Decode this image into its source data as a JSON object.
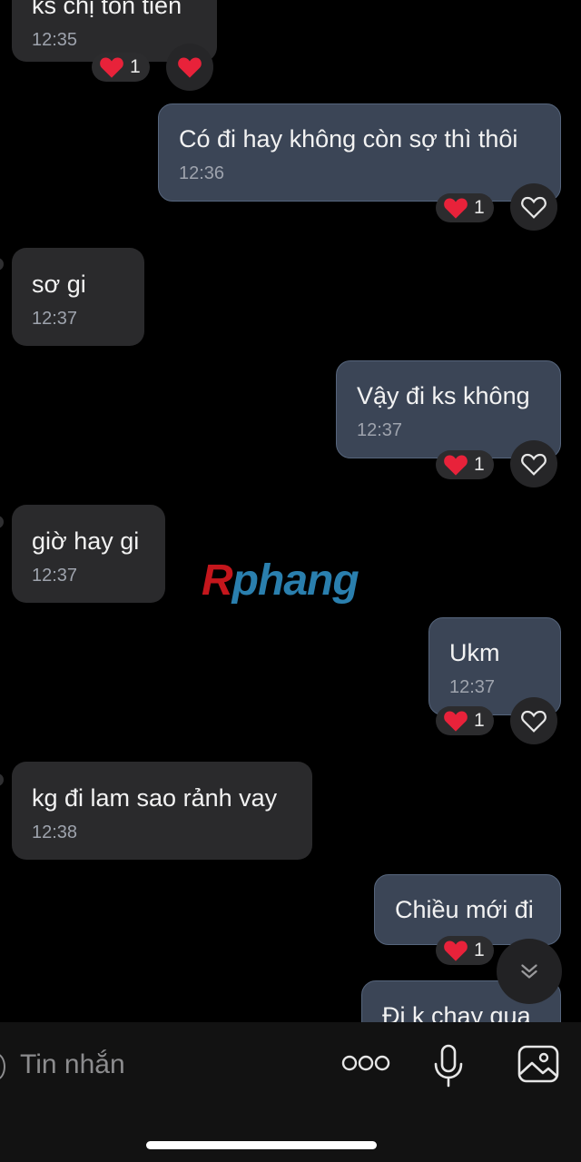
{
  "messages": [
    {
      "dir": "in",
      "text": "ks chị tốn tiền",
      "time": "12:35",
      "reaction_count": "1"
    },
    {
      "dir": "out",
      "text": "Có đi hay không còn sợ thì thôi",
      "time": "12:36",
      "reaction_count": "1"
    },
    {
      "dir": "in",
      "text": "sơ gi",
      "time": "12:37"
    },
    {
      "dir": "out",
      "text": "Vậy đi ks không",
      "time": "12:37",
      "reaction_count": "1"
    },
    {
      "dir": "in",
      "text": "giờ hay gi",
      "time": "12:37"
    },
    {
      "dir": "out",
      "text": "Ukm",
      "time": "12:37",
      "reaction_count": "1"
    },
    {
      "dir": "in",
      "text": "kg đi lam sao rảnh vay",
      "time": "12:38"
    },
    {
      "dir": "out",
      "text": "Chiều mới đi",
      "time": "",
      "reaction_count": "1"
    },
    {
      "dir": "out",
      "text": "Đi k chay qua",
      "time": ""
    }
  ],
  "watermark": {
    "first": "R",
    "rest": "phang"
  },
  "composer": {
    "placeholder": "Tin nhắn",
    "icons": [
      "more-icon",
      "microphone-icon",
      "image-icon"
    ]
  },
  "colors": {
    "background": "#000000",
    "incoming_bubble": "#2a2a2c",
    "outgoing_bubble": "#3b4556",
    "heart_red": "#e8223a"
  }
}
